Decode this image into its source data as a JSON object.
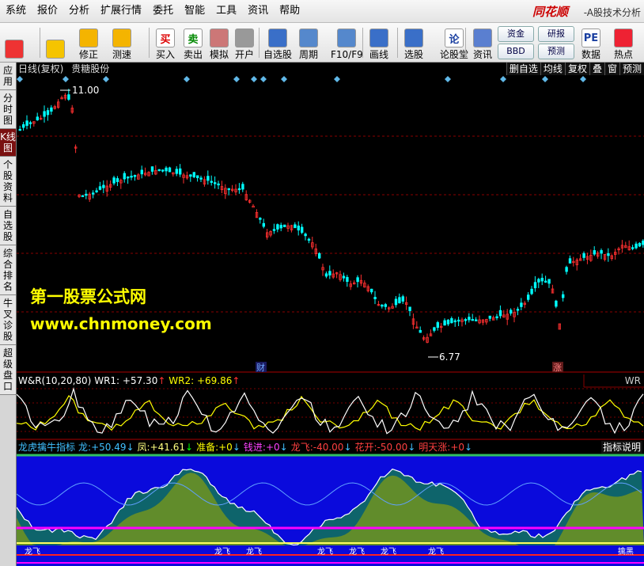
{
  "menu": [
    "系统",
    "报价",
    "分析",
    "扩展行情",
    "委托",
    "智能",
    "工具",
    "资讯",
    "帮助"
  ],
  "brand": {
    "name": "同花顺",
    "subtitle": "-A股技术分析"
  },
  "toolbar": {
    "buttons": [
      {
        "label": "",
        "icon": "color-squares-icon"
      },
      {
        "label": "",
        "icon": "back-arrow-icon"
      },
      {
        "label": "修正",
        "icon": "up-down-arrows-icon"
      },
      {
        "label": "测速",
        "icon": "clock-icon"
      },
      {
        "label": "买入",
        "icon": "buy-icon",
        "glyph": "买"
      },
      {
        "label": "卖出",
        "icon": "sell-icon",
        "glyph": "卖"
      },
      {
        "label": "模拟",
        "icon": "hammer-icon"
      },
      {
        "label": "开户",
        "icon": "lock-icon"
      },
      {
        "label": "自选股",
        "icon": "star-folder-icon"
      },
      {
        "label": "周期",
        "icon": "cycle-icon"
      },
      {
        "label": "F10/F9",
        "icon": "f10-icon"
      },
      {
        "label": "画线",
        "icon": "pencil-icon"
      },
      {
        "label": "选股",
        "icon": "chart-select-icon"
      },
      {
        "label": "论股堂",
        "icon": "forum-icon",
        "glyph": "论"
      },
      {
        "label": "资讯",
        "icon": "news-icon"
      },
      {
        "label": "数据",
        "icon": "pe-data-icon",
        "glyph": "PE"
      },
      {
        "label": "热点",
        "icon": "hot-icon"
      }
    ],
    "small_buttons": [
      "资金",
      "研报",
      "BBD",
      "预测"
    ]
  },
  "sidebar": [
    "应用",
    "分时图",
    "K线图",
    "个股资料",
    "自选股",
    "综合排名",
    "牛叉诊股",
    "超级盘口"
  ],
  "sidebar_active": 2,
  "chart": {
    "header": [
      "日线(复权)",
      "贵糖股份"
    ],
    "tool_buttons": [
      "删自选",
      "均线",
      "复权",
      "叠",
      "窗",
      "预测"
    ],
    "price_high_label": "11.00",
    "price_low_label": "6.77",
    "marker_cai": "财",
    "marker_zhang": "涨"
  },
  "watermark": {
    "line1": "第一股票公式网",
    "line2": "www.chnmoney.com"
  },
  "wr_panel": {
    "name": "W&R(10,20,80)",
    "wr1_label": "WR1:",
    "wr1_value": "+57.30",
    "wr1_arrow": "↑",
    "wr2_label": "WR2:",
    "wr2_value": "+69.86",
    "wr2_arrow": "↑",
    "tag": "WR"
  },
  "indicator_panel": {
    "name": "龙虎擒牛指标",
    "items": [
      {
        "label": "龙:",
        "value": "+50.49",
        "arrow": "↓",
        "color": "#40c0ff"
      },
      {
        "label": "凤:",
        "value": "+41.61",
        "arrow": "↓",
        "color": "#ffff80"
      },
      {
        "label": "准备:",
        "value": "+0",
        "arrow": "↓",
        "color": "#ffff00"
      },
      {
        "label": "钱进:",
        "value": "+0",
        "arrow": "↓",
        "color": "#ff40ff"
      },
      {
        "label": "龙飞:",
        "value": "-40.00",
        "arrow": "↓",
        "color": "#ff4040"
      },
      {
        "label": "花开:",
        "value": "-50.00",
        "arrow": "↓",
        "color": "#ff4040"
      },
      {
        "label": "明天涨:",
        "value": "+0",
        "arrow": "↓",
        "color": "#ff4040"
      }
    ],
    "help": "指标说明",
    "bottom_labels": [
      "龙飞",
      "龙飞",
      "龙飞",
      "龙飞",
      "龙飞",
      "龙飞",
      "龙飞",
      "擒黑"
    ]
  },
  "colors": {
    "up": "#ff3030",
    "down": "#00ffff",
    "panel_blue": "#0a0adc",
    "grid_red": "#8a0000"
  }
}
